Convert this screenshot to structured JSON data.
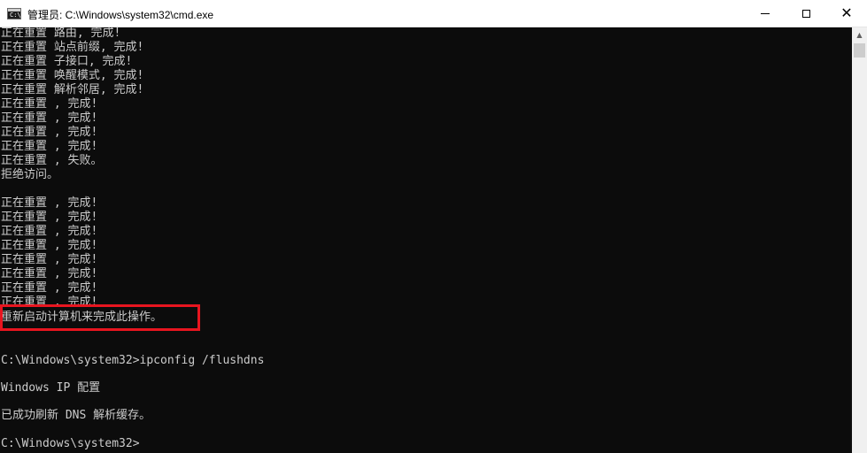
{
  "window": {
    "title": "管理员: C:\\Windows\\system32\\cmd.exe",
    "app_icon_glyph": "C:\\",
    "controls": {
      "minimize": "minimize",
      "maximize": "maximize",
      "close": "✕"
    }
  },
  "console": {
    "lines": [
      "正在重置 路由, 完成!",
      "正在重置 站点前缀, 完成!",
      "正在重置 子接口, 完成!",
      "正在重置 唤醒模式, 完成!",
      "正在重置 解析邻居, 完成!",
      "正在重置 , 完成!",
      "正在重置 , 完成!",
      "正在重置 , 完成!",
      "正在重置 , 完成!",
      "正在重置 , 失败。",
      "拒绝访问。",
      "",
      "正在重置 , 完成!",
      "正在重置 , 完成!",
      "正在重置 , 完成!",
      "正在重置 , 完成!",
      "正在重置 , 完成!",
      "正在重置 , 完成!",
      "正在重置 , 完成!",
      "正在重置 , 完成!",
      "重新启动计算机来完成此操作。",
      "",
      "",
      "C:\\Windows\\system32>ipconfig /flushdns",
      "",
      "Windows IP 配置",
      "",
      "已成功刷新 DNS 解析缓存。",
      "",
      "C:\\Windows\\system32>"
    ],
    "highlighted_line": "重新启动计算机来完成此操作。"
  },
  "colors": {
    "console_background": "#0c0c0c",
    "console_text": "#cccccc",
    "highlight_border": "#e8151f"
  }
}
